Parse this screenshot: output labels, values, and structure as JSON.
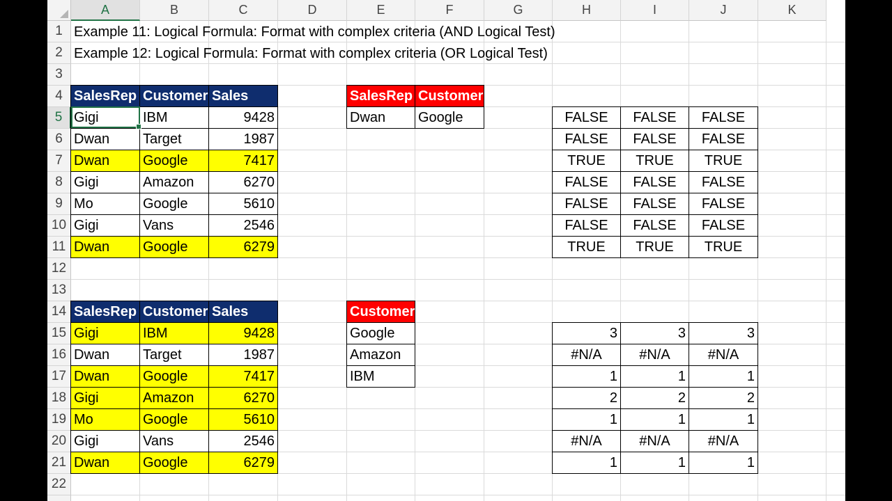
{
  "columns": [
    "A",
    "B",
    "C",
    "D",
    "E",
    "F",
    "G",
    "H",
    "I",
    "J",
    "K"
  ],
  "selected_column": "A",
  "rows": [
    "1",
    "2",
    "3",
    "4",
    "5",
    "6",
    "7",
    "8",
    "9",
    "10",
    "11",
    "12",
    "13",
    "14",
    "15",
    "16",
    "17",
    "18",
    "19",
    "20",
    "21",
    "22"
  ],
  "selected_row": "5",
  "titles": {
    "r1": "Example 11: Logical Formula: Format with complex criteria (AND Logical Test)",
    "r2": "Example 12: Logical Formula: Format with complex criteria (OR Logical Test)"
  },
  "table1": {
    "headers": [
      "SalesRep",
      "Customer",
      "Sales"
    ],
    "rows": [
      {
        "rep": "Gigi",
        "cust": "IBM",
        "sales": "9428",
        "highlight": false
      },
      {
        "rep": "Dwan",
        "cust": "Target",
        "sales": "1987",
        "highlight": false
      },
      {
        "rep": "Dwan",
        "cust": "Google",
        "sales": "7417",
        "highlight": true
      },
      {
        "rep": "Gigi",
        "cust": "Amazon",
        "sales": "6270",
        "highlight": false
      },
      {
        "rep": "Mo",
        "cust": "Google",
        "sales": "5610",
        "highlight": false
      },
      {
        "rep": "Gigi",
        "cust": "Vans",
        "sales": "2546",
        "highlight": false
      },
      {
        "rep": "Dwan",
        "cust": "Google",
        "sales": "6279",
        "highlight": true
      }
    ]
  },
  "criteria1": {
    "headers": [
      "SalesRep",
      "Customer"
    ],
    "values": [
      "Dwan",
      "Google"
    ]
  },
  "logic1": [
    [
      "FALSE",
      "FALSE",
      "FALSE"
    ],
    [
      "FALSE",
      "FALSE",
      "FALSE"
    ],
    [
      "TRUE",
      "TRUE",
      "TRUE"
    ],
    [
      "FALSE",
      "FALSE",
      "FALSE"
    ],
    [
      "FALSE",
      "FALSE",
      "FALSE"
    ],
    [
      "FALSE",
      "FALSE",
      "FALSE"
    ],
    [
      "TRUE",
      "TRUE",
      "TRUE"
    ]
  ],
  "table2": {
    "headers": [
      "SalesRep",
      "Customer",
      "Sales"
    ],
    "rows": [
      {
        "rep": "Gigi",
        "cust": "IBM",
        "sales": "9428",
        "highlight": true
      },
      {
        "rep": "Dwan",
        "cust": "Target",
        "sales": "1987",
        "highlight": false
      },
      {
        "rep": "Dwan",
        "cust": "Google",
        "sales": "7417",
        "highlight": true
      },
      {
        "rep": "Gigi",
        "cust": "Amazon",
        "sales": "6270",
        "highlight": true
      },
      {
        "rep": "Mo",
        "cust": "Google",
        "sales": "5610",
        "highlight": true
      },
      {
        "rep": "Gigi",
        "cust": "Vans",
        "sales": "2546",
        "highlight": false
      },
      {
        "rep": "Dwan",
        "cust": "Google",
        "sales": "6279",
        "highlight": true
      }
    ]
  },
  "criteria2": {
    "header": "Customer",
    "values": [
      "Google",
      "Amazon",
      "IBM"
    ]
  },
  "logic2": [
    [
      "3",
      "3",
      "3"
    ],
    [
      "#N/A",
      "#N/A",
      "#N/A"
    ],
    [
      "1",
      "1",
      "1"
    ],
    [
      "2",
      "2",
      "2"
    ],
    [
      "1",
      "1",
      "1"
    ],
    [
      "#N/A",
      "#N/A",
      "#N/A"
    ],
    [
      "1",
      "1",
      "1"
    ]
  ],
  "colors": {
    "header_blue": "#0f2d6e",
    "header_red": "#ff0000",
    "highlight_yellow": "#ffff00",
    "excel_green": "#217346"
  }
}
